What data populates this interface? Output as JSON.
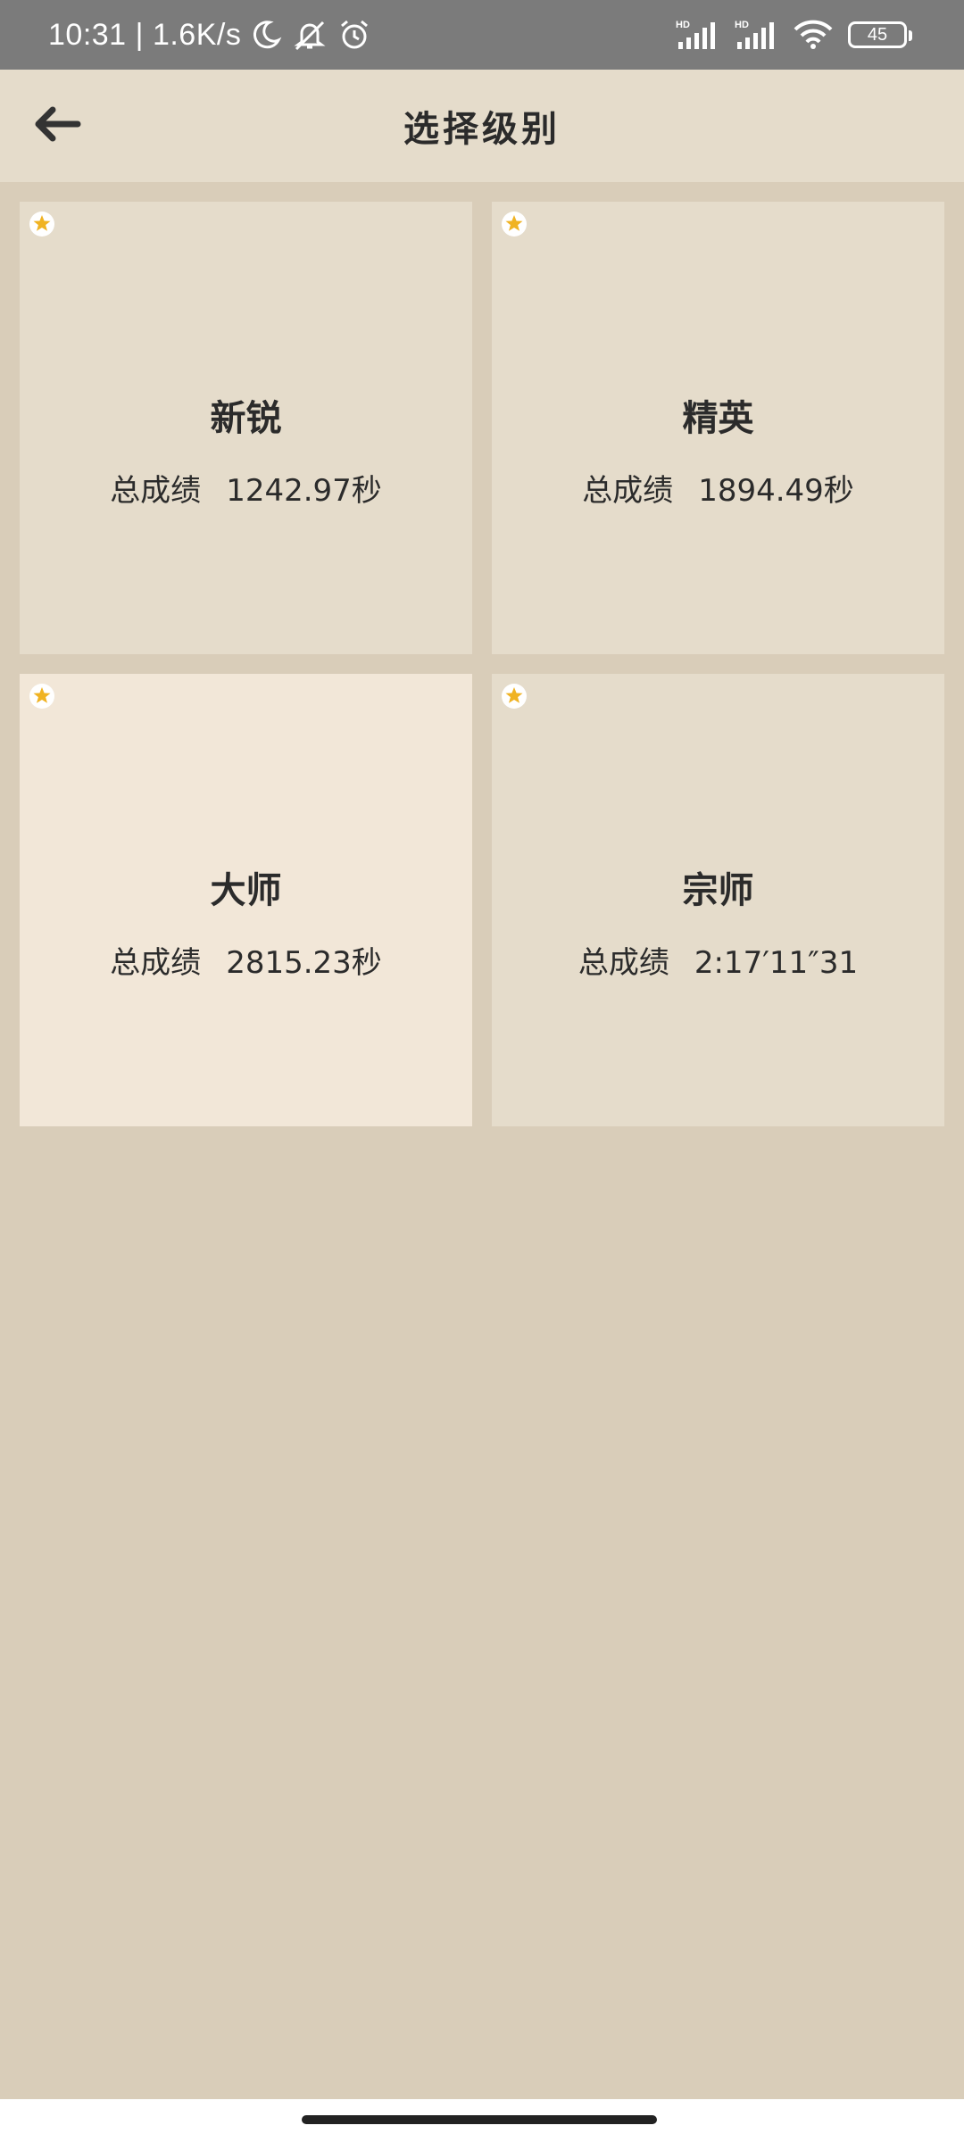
{
  "status_bar": {
    "time": "10:31",
    "separator": "|",
    "network_speed": "1.6K/s",
    "battery": "45",
    "icons": [
      "moon-icon",
      "mute-icon",
      "alarm-icon",
      "hd-signal-icon",
      "hd-signal-icon",
      "wifi-icon",
      "battery-icon"
    ]
  },
  "header": {
    "title": "选择级别",
    "back_icon": "arrow-left-icon"
  },
  "levels": [
    {
      "name": "新锐",
      "score_label": "总成绩",
      "score": "1242.97秒",
      "starred": true
    },
    {
      "name": "精英",
      "score_label": "总成绩",
      "score": "1894.49秒",
      "starred": true
    },
    {
      "name": "大师",
      "score_label": "总成绩",
      "score": "2815.23秒",
      "starred": true
    },
    {
      "name": "宗师",
      "score_label": "总成绩",
      "score": "2:17′11″31",
      "starred": true
    }
  ],
  "colors": {
    "background": "#d9cdb9",
    "card": "#e5dccb",
    "card_selected": "#f2e7d8",
    "star": "#f0b323",
    "text": "#2b2b2b"
  }
}
